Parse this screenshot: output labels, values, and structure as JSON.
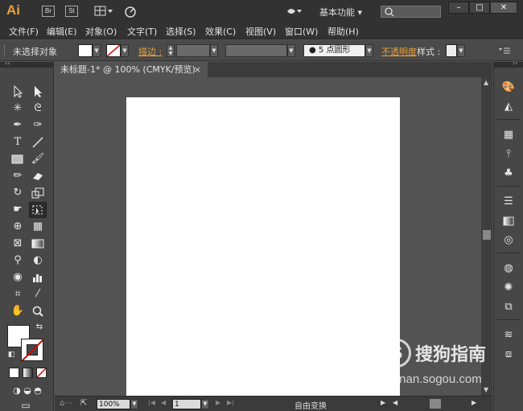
{
  "title_bar": {
    "logo": "Ai",
    "bridge_btn": "Br",
    "stock_btn": "St",
    "workspace_label": "基本功能",
    "window_controls": {
      "minimize": "–",
      "maximize": "□",
      "close": "✕"
    }
  },
  "menu": [
    "文件(F)",
    "编辑(E)",
    "对象(O)",
    "文字(T)",
    "选择(S)",
    "效果(C)",
    "视图(V)",
    "窗口(W)",
    "帮助(H)"
  ],
  "control_bar": {
    "selection_status": "未选择对象",
    "stroke_label": "描边 :",
    "brush_value": "●  5 点圆形",
    "opacity_label": "不透明度",
    "style_label": "样式 :"
  },
  "document_tab": {
    "title": "未标题-1* @ 100% (CMYK/预览)",
    "close": "×"
  },
  "status_bar": {
    "zoom_value": "100%",
    "artboard_number": "1",
    "status_text": "自由变换"
  },
  "watermark": {
    "logo": "S",
    "title": "搜狗指南",
    "url": "zhinan.sogou.com"
  },
  "colors": {
    "accent": "#e8a23a",
    "ui_dark": "#323232",
    "panel": "#474747",
    "canvas": "#535353"
  }
}
